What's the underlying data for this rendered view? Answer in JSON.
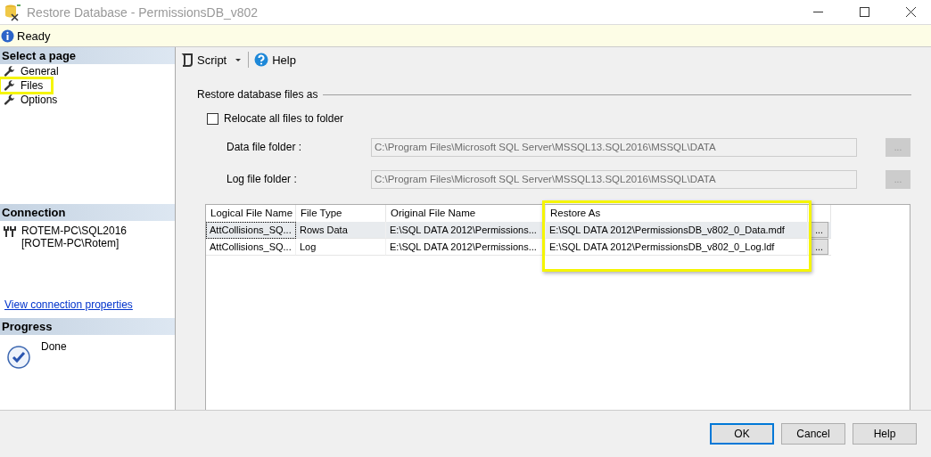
{
  "window": {
    "title": "Restore Database - PermissionsDB_v802"
  },
  "status": {
    "text": "Ready"
  },
  "sidebar": {
    "heading": "Select a page",
    "items": [
      {
        "label": "General",
        "highlighted": false
      },
      {
        "label": "Files",
        "highlighted": true
      },
      {
        "label": "Options",
        "highlighted": false
      }
    ]
  },
  "connection": {
    "heading": "Connection",
    "server": "ROTEM-PC\\SQL2016",
    "user": "[ROTEM-PC\\Rotem]",
    "link": "View connection properties"
  },
  "progress": {
    "heading": "Progress",
    "text": "Done"
  },
  "toolbar": {
    "script": "Script",
    "help": "Help"
  },
  "section": {
    "title": "Restore database files as"
  },
  "relocate": {
    "label": "Relocate all files to folder",
    "checked": false
  },
  "folders": [
    {
      "label": "Data file folder :",
      "value": "C:\\Program Files\\Microsoft SQL Server\\MSSQL13.SQL2016\\MSSQL\\DATA",
      "browse": "..."
    },
    {
      "label": "Log file folder :",
      "value": "C:\\Program Files\\Microsoft SQL Server\\MSSQL13.SQL2016\\MSSQL\\DATA",
      "browse": "..."
    }
  ],
  "table": {
    "columns": [
      {
        "label": "Logical File Name",
        "highlighted": false
      },
      {
        "label": "File Type",
        "highlighted": false
      },
      {
        "label": "Original File Name",
        "highlighted": false
      },
      {
        "label": "Restore As",
        "highlighted": true
      }
    ],
    "rows": [
      {
        "selected": true,
        "cells": [
          "AttCollisions_SQ...",
          "Rows Data",
          "E:\\SQL DATA 2012\\Permissions...",
          "E:\\SQL DATA 2012\\PermissionsDB_v802_0_Data.mdf"
        ],
        "browse": "..."
      },
      {
        "selected": false,
        "cells": [
          "AttCollisions_SQ...",
          "Log",
          "E:\\SQL DATA 2012\\Permissions...",
          "E:\\SQL DATA 2012\\PermissionsDB_v802_0_Log.ldf"
        ],
        "browse": "..."
      }
    ]
  },
  "buttons": [
    {
      "label": "OK",
      "default": true
    },
    {
      "label": "Cancel",
      "default": false
    },
    {
      "label": "Help",
      "default": false
    }
  ]
}
